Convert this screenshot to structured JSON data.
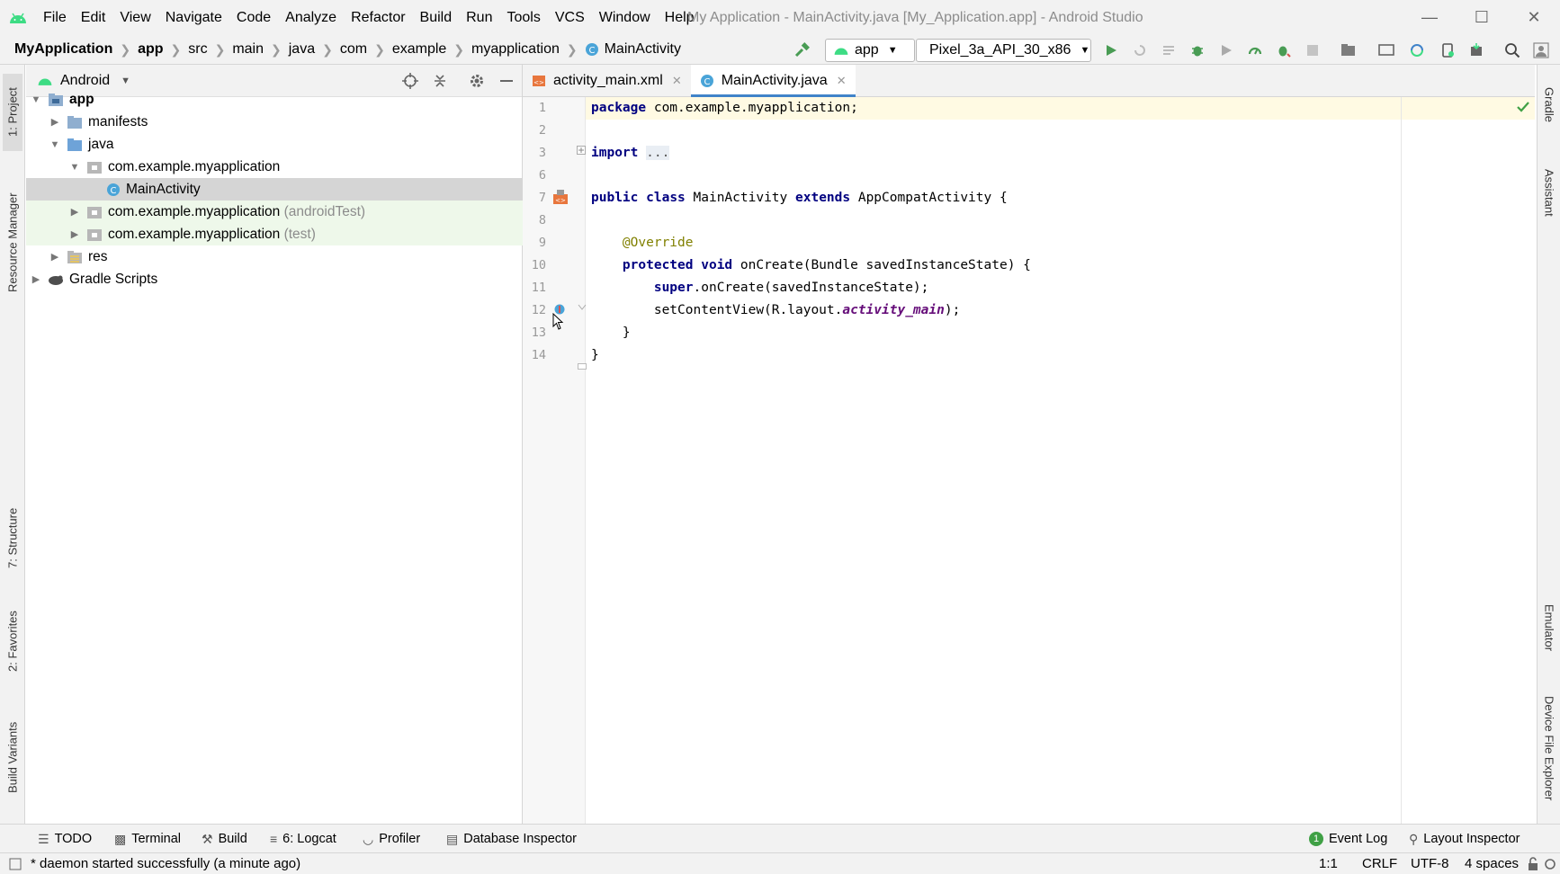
{
  "window": {
    "title": "My Application - MainActivity.java [My_Application.app] - Android Studio",
    "menu": [
      "File",
      "Edit",
      "View",
      "Navigate",
      "Code",
      "Analyze",
      "Refactor",
      "Build",
      "Run",
      "Tools",
      "VCS",
      "Window",
      "Help"
    ]
  },
  "breadcrumb": [
    "MyApplication",
    "app",
    "src",
    "main",
    "java",
    "com",
    "example",
    "myapplication",
    "MainActivity"
  ],
  "toolbar": {
    "run_config": "app",
    "device": "Pixel_3a_API_30_x86"
  },
  "left_stripe": {
    "project": "1: Project",
    "resource_manager": "Resource Manager",
    "structure": "7: Structure",
    "favorites": "2: Favorites",
    "build_variants": "Build Variants"
  },
  "right_stripe": {
    "gradle": "Gradle",
    "assistant": "Assistant",
    "emulator": "Emulator",
    "device_file_explorer": "Device File Explorer"
  },
  "project_panel": {
    "view": "Android",
    "tree": [
      {
        "label": "app",
        "suffix": ""
      },
      {
        "label": "manifests",
        "suffix": ""
      },
      {
        "label": "java",
        "suffix": ""
      },
      {
        "label": "com.example.myapplication",
        "suffix": ""
      },
      {
        "label": "MainActivity",
        "suffix": ""
      },
      {
        "label": "com.example.myapplication",
        "suffix": "(androidTest)"
      },
      {
        "label": "com.example.myapplication",
        "suffix": "(test)"
      },
      {
        "label": "res",
        "suffix": ""
      },
      {
        "label": "Gradle Scripts",
        "suffix": ""
      }
    ]
  },
  "editor": {
    "tabs": [
      "activity_main.xml",
      "MainActivity.java"
    ],
    "line_numbers": [
      "1",
      "2",
      "3",
      "6",
      "7",
      "8",
      "9",
      "10",
      "11",
      "12",
      "13",
      "14"
    ],
    "code": {
      "l1_kw": "package",
      "l1_rest": " com.example.myapplication;",
      "l3_kw": "import",
      "l3_fold": "...",
      "l7_kw1": "public",
      "l7_kw2": "class",
      "l7_name": " MainActivity ",
      "l7_kw3": "extends",
      "l7_rest": " AppCompatActivity {",
      "l9_ann": "@Override",
      "l10_kw1": "protected",
      "l10_kw2": "void",
      "l10_rest": " onCreate(Bundle savedInstanceState) {",
      "l11_kw": "super",
      "l11_rest": ".onCreate(savedInstanceState);",
      "l12_a": "setContentView(R.layout.",
      "l12_field": "activity_main",
      "l12_b": ");",
      "l13": "}",
      "l14": "}"
    }
  },
  "bottom_tools": {
    "todo": "TODO",
    "terminal": "Terminal",
    "build": "Build",
    "logcat": "6: Logcat",
    "profiler": "Profiler",
    "database_inspector": "Database Inspector",
    "event_log": "Event Log",
    "event_log_count": "1",
    "layout_inspector": "Layout Inspector"
  },
  "status": {
    "message": "* daemon started successfully (a minute ago)",
    "position": "1:1",
    "line_sep": "CRLF",
    "encoding": "UTF-8",
    "indent": "4 spaces"
  },
  "colors": {
    "android_green": "#3ddc84",
    "run_green": "#499c54",
    "tab_accent": "#4083c9",
    "keyword": "#000080",
    "annotation": "#808000"
  }
}
